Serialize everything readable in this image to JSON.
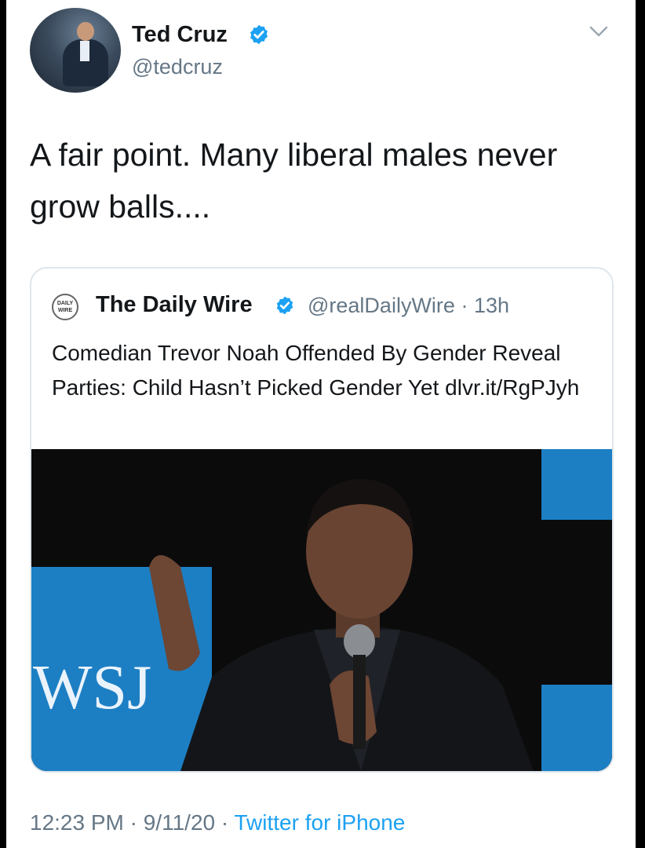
{
  "tweet": {
    "author_name": "Ted Cruz",
    "author_handle": "@tedcruz",
    "text": "A fair point. Many liberal males never grow balls....",
    "time": "12:23 PM",
    "date": "9/11/20",
    "source": "Twitter for iPhone",
    "separator": "·"
  },
  "quoted": {
    "author_name": "The Daily Wire",
    "author_handle": "@realDailyWire",
    "age": "13h",
    "logo_text_1": "DAILY",
    "logo_text_2": "WIRE",
    "text": "Comedian Trevor Noah Offended By Gender Reveal Parties: Child Hasn’t Picked Gender Yet dlvr.it/RgPJyh",
    "image_sign_text": "WSJ"
  },
  "icons": {
    "verified": "verified-badge-icon",
    "more": "chevron-down-icon"
  },
  "colors": {
    "verified_blue": "#1da1f2",
    "link_blue": "#1da1f2",
    "secondary_text": "#657786",
    "primary_text": "#14171a",
    "backdrop_blue": "#1c7fc4"
  }
}
